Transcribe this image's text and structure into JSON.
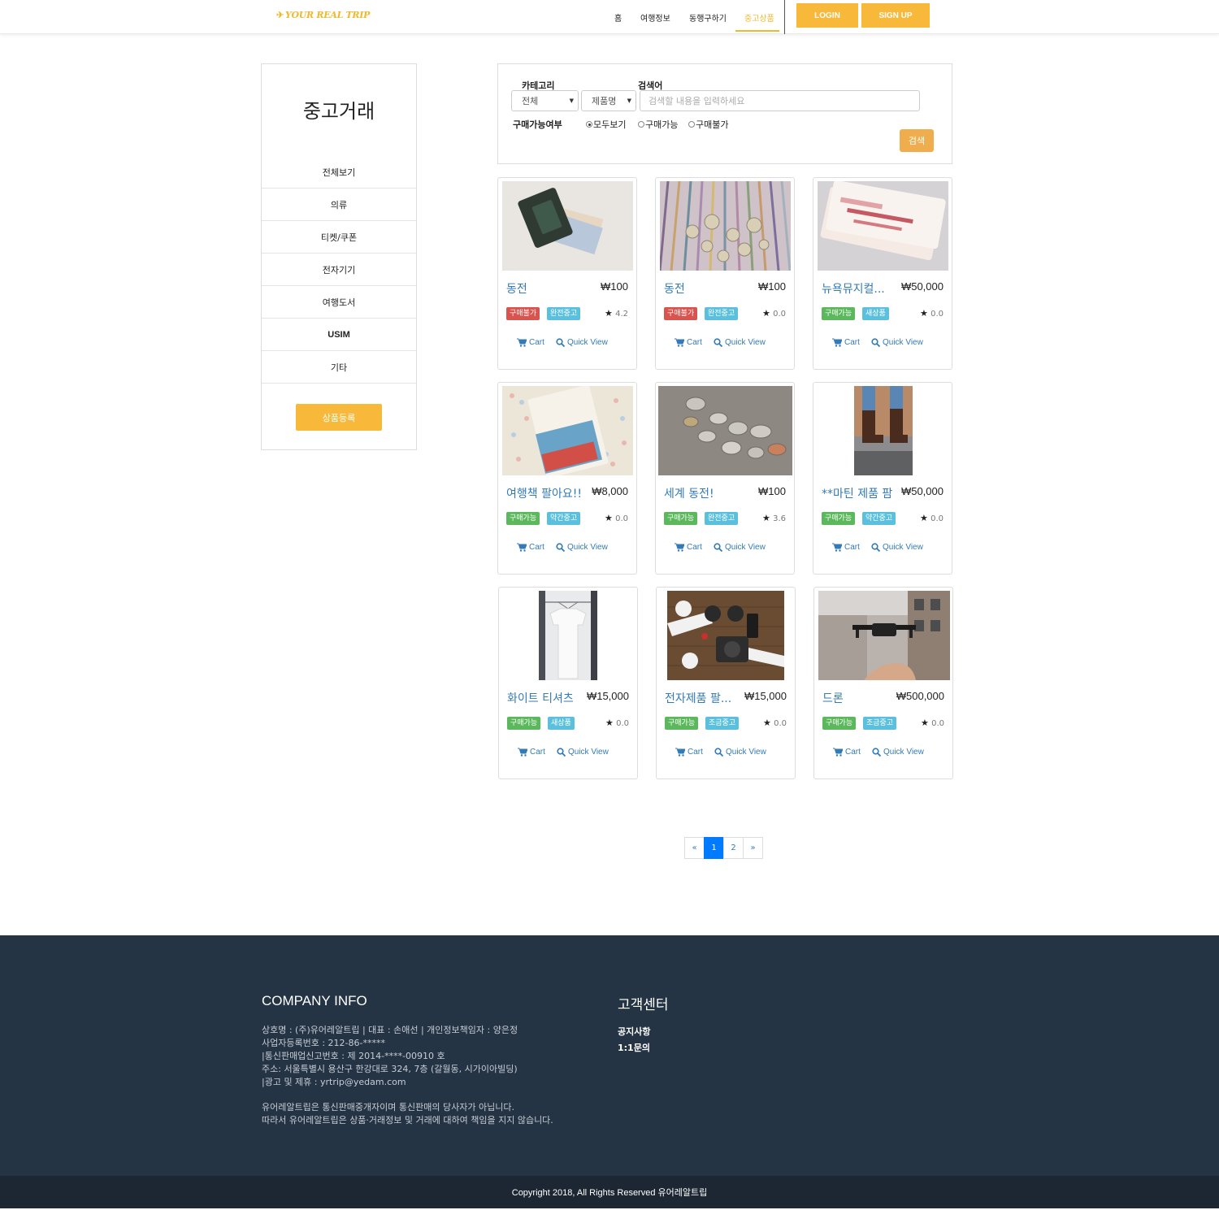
{
  "nav": {
    "logo": "YOUR REAL TRIP",
    "links": [
      "홈",
      "여행정보",
      "동행구하기",
      "중고상품"
    ],
    "login": "LOGIN",
    "signup": "SIGN UP"
  },
  "sidebar": {
    "title": "중고거래",
    "items": [
      "전체보기",
      "의류",
      "티켓/쿠폰",
      "전자기기",
      "여행도서",
      "USIM",
      "기타"
    ],
    "register": "상품등록"
  },
  "search": {
    "category_label": "카테고리",
    "keyword_label": "검색어",
    "category_value": "전체",
    "field_value": "제품명",
    "placeholder": "검색할 내용을 입력하세요",
    "availability_label": "구매가능여부",
    "radios": [
      "모두보기",
      "구매가능",
      "구매불가"
    ],
    "button": "검색"
  },
  "products": [
    {
      "name": "동전",
      "price": "₩100",
      "status": "구매불가",
      "condition": "완전중고",
      "rating": "4.2",
      "image": "wallet-with-banknotes"
    },
    {
      "name": "동전",
      "price": "₩100",
      "status": "구매불가",
      "condition": "완전중고",
      "rating": "0.0",
      "image": "banknotes-and-coins"
    },
    {
      "name": "뉴욕뮤지컬...",
      "price": "₩50,000",
      "status": "구매가능",
      "condition": "새상품",
      "rating": "0.0",
      "image": "musical-tickets"
    },
    {
      "name": "여행책 팔아요!!",
      "price": "₩8,000",
      "status": "구매가능",
      "condition": "약간중고",
      "rating": "0.0",
      "image": "travel-book"
    },
    {
      "name": "세계 동전!",
      "price": "₩100",
      "status": "구매가능",
      "condition": "완전중고",
      "rating": "3.6",
      "image": "world-coins"
    },
    {
      "name": "**마틴 제품 팜",
      "price": "₩50,000",
      "status": "구매가능",
      "condition": "약간중고",
      "rating": "0.0",
      "image": "boots"
    },
    {
      "name": "화이트 티셔츠",
      "price": "₩15,000",
      "status": "구매가능",
      "condition": "새상품",
      "rating": "0.0",
      "image": "white-tshirt"
    },
    {
      "name": "전자제품 팔...",
      "price": "₩15,000",
      "status": "구매가능",
      "condition": "조금중고",
      "rating": "0.0",
      "image": "drone-and-camera"
    },
    {
      "name": "드론",
      "price": "₩500,000",
      "status": "구매가능",
      "condition": "조금중고",
      "rating": "0.0",
      "image": "drone-flying"
    }
  ],
  "card_actions": {
    "cart": "Cart",
    "quick_view": "Quick View"
  },
  "pagination": {
    "prev": "«",
    "pages": [
      "1",
      "2"
    ],
    "next": "»",
    "current": "1"
  },
  "footer": {
    "company_title": "COMPANY INFO",
    "company_lines": [
      "상호명 : (주)유어레알트립 | 대표 : 손애선 | 개인정보책임자 : 양은정",
      "사업자등록번호 : 212-86-*****",
      "|통신판매업신고번호 : 제 2014-****-00910 호",
      "주소: 서울특별시 용산구 한강대로 324, 7층 (갈월동, 시가이아빌딩)",
      "|광고 및 제휴 : yrtrip@yedam.com",
      "유어레알트립은 통신판매중개자이며 통신판매의 당사자가 아닙니다.",
      "따라서 유어레알트립은 상품·거래정보 및 거래에 대하여 책임을 지지 않습니다."
    ],
    "support_title": "고객센터",
    "support_links": [
      "공지사항",
      "1:1문의"
    ],
    "copyright": "Copyright 2018, All Rights Reserved 유어레알트립"
  },
  "colors": {
    "accent": "#f8b93a",
    "link": "#337ab7",
    "status_unavailable": "#d9534f",
    "status_available": "#5cb85c",
    "condition": "#5bc0de",
    "footer_bg": "#253445"
  }
}
